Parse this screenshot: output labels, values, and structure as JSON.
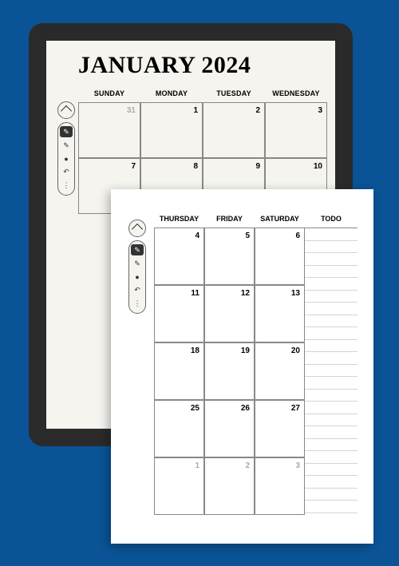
{
  "page1": {
    "title": "JANUARY 2024",
    "headers": [
      "SUNDAY",
      "MONDAY",
      "TUESDAY",
      "WEDNESDAY"
    ],
    "rows": [
      [
        {
          "d": "31",
          "muted": true
        },
        {
          "d": "1"
        },
        {
          "d": "2"
        },
        {
          "d": "3"
        }
      ],
      [
        {
          "d": "7"
        },
        {
          "d": "8"
        },
        {
          "d": "9"
        },
        {
          "d": "10"
        }
      ]
    ]
  },
  "page2": {
    "headers": [
      "THURSDAY",
      "FRIDAY",
      "SATURDAY"
    ],
    "todo_label": "TODO",
    "rows": [
      [
        {
          "d": "4"
        },
        {
          "d": "5"
        },
        {
          "d": "6"
        }
      ],
      [
        {
          "d": "11"
        },
        {
          "d": "12"
        },
        {
          "d": "13"
        }
      ],
      [
        {
          "d": "18"
        },
        {
          "d": "19"
        },
        {
          "d": "20"
        }
      ],
      [
        {
          "d": "25"
        },
        {
          "d": "26"
        },
        {
          "d": "27"
        }
      ],
      [
        {
          "d": "1",
          "muted": true
        },
        {
          "d": "2",
          "muted": true
        },
        {
          "d": "3",
          "muted": true
        }
      ]
    ]
  },
  "toolbar": {
    "items": [
      "pen",
      "pen2",
      "marker",
      "undo",
      "more"
    ]
  }
}
